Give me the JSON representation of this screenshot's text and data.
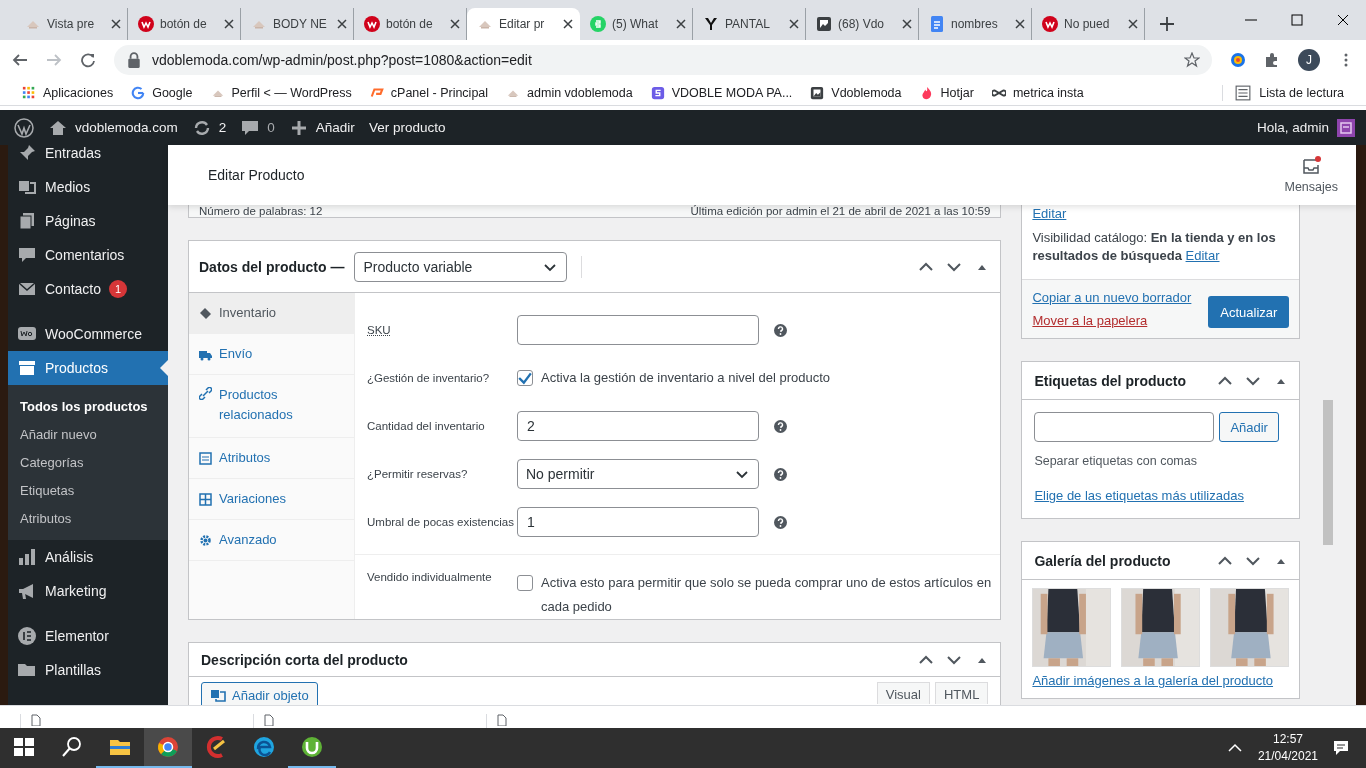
{
  "browser": {
    "tabs": [
      {
        "title": "Vista pre",
        "selected": false
      },
      {
        "title": "botón de",
        "selected": false
      },
      {
        "title": "BODY NE",
        "selected": false
      },
      {
        "title": "botón de",
        "selected": false
      },
      {
        "title": "Editar pr",
        "selected": true
      },
      {
        "title": "(5) What",
        "selected": false
      },
      {
        "title": "PANTAL",
        "selected": false
      },
      {
        "title": "(68) Vdo",
        "selected": false
      },
      {
        "title": "nombres",
        "selected": false
      },
      {
        "title": "No pued",
        "selected": false
      }
    ],
    "url": "vdoblemoda.com/wp-admin/post.php?post=1080&action=edit",
    "profile": "J",
    "bookmarks": [
      {
        "label": "Aplicaciones"
      },
      {
        "label": "Google"
      },
      {
        "label": "Perfil < — WordPress"
      },
      {
        "label": "cPanel - Principal"
      },
      {
        "label": "admin vdoblemoda"
      },
      {
        "label": "VDOBLE MODA PA..."
      },
      {
        "label": "Vdoblemoda"
      },
      {
        "label": "Hotjar"
      },
      {
        "label": "metrica insta"
      }
    ],
    "reading_list": "Lista de lectura"
  },
  "admin_bar": {
    "site": "vdoblemoda.com",
    "updates": "2",
    "comments": "0",
    "add": "Añadir",
    "view": "Ver producto",
    "greeting": "Hola, admin"
  },
  "sidebar": {
    "items": [
      {
        "label": "Entradas",
        "selected": false
      },
      {
        "label": "Medios",
        "selected": false
      },
      {
        "label": "Páginas",
        "selected": false
      },
      {
        "label": "Comentarios",
        "selected": false
      },
      {
        "label": "Contacto",
        "selected": false,
        "badge": "1"
      },
      {
        "label": "WooCommerce",
        "selected": false
      },
      {
        "label": "Productos",
        "selected": true,
        "children": [
          {
            "label": "Todos los productos",
            "selected": true
          },
          {
            "label": "Añadir nuevo",
            "selected": false
          },
          {
            "label": "Categorías",
            "selected": false
          },
          {
            "label": "Etiquetas",
            "selected": false
          },
          {
            "label": "Atributos",
            "selected": false
          }
        ]
      },
      {
        "label": "Análisis",
        "selected": false
      },
      {
        "label": "Marketing",
        "selected": false
      },
      {
        "label": "Elementor",
        "selected": false
      },
      {
        "label": "Plantillas",
        "selected": false
      }
    ]
  },
  "header": {
    "title": "Editar Producto",
    "messages": "Mensajes",
    "unread": true
  },
  "editor_status": {
    "word_count": "Número de palabras: 12",
    "last_edit": "Última edición por admin el 21 de abril de 2021 a las 10:59"
  },
  "product_data": {
    "title": "Datos del producto —",
    "product_type": "Producto variable",
    "tabs": [
      {
        "label": "Inventario",
        "selected": true
      },
      {
        "label": "Envío",
        "selected": false
      },
      {
        "label": "Productos relacionados",
        "selected": false
      },
      {
        "label": "Atributos",
        "selected": false
      },
      {
        "label": "Variaciones",
        "selected": false
      },
      {
        "label": "Avanzado",
        "selected": false
      }
    ],
    "fields": [
      {
        "kind": "input",
        "label": "SKU"
      },
      {
        "kind": "checkbox",
        "label": "¿Gestión de inventario?",
        "text": "Activa la gestión de inventario a nivel del producto",
        "checked": true
      },
      {
        "kind": "input",
        "label": "Cantidad del inventario",
        "value": "2"
      },
      {
        "kind": "select",
        "label": "¿Permitir reservas?",
        "value": "No permitir"
      },
      {
        "kind": "input",
        "label": "Umbral de pocas existencias",
        "value": "1"
      },
      {
        "kind": "checkbox",
        "label": "Vendido individualmente",
        "text": "Activa esto para permitir que solo se pueda comprar uno de estos artículos en cada pedido",
        "checked": false
      }
    ]
  },
  "short_description": {
    "title": "Descripción corta del producto",
    "add_media": "Añadir objeto",
    "editor_tabs": [
      {
        "label": "Visual"
      },
      {
        "label": "HTML"
      }
    ]
  },
  "publish": {
    "edit_link": "Editar",
    "visibility_label": "Visibilidad catálogo:",
    "visibility_value": "En la tienda y en los resultados de búsqueda",
    "visibility_edit": "Editar",
    "copy": "Copiar a un nuevo borrador",
    "trash": "Mover a la papelera",
    "update": "Actualizar"
  },
  "tags": {
    "title": "Etiquetas del producto",
    "add": "Añadir",
    "hint": "Separar etiquetas con comas",
    "popular": "Elige de las etiquetas más utilizadas"
  },
  "gallery": {
    "title": "Galería del producto",
    "add_link": "Añadir imágenes a la galería del producto"
  },
  "taskbar": {
    "time": "12:57",
    "date": "21/04/2021"
  }
}
